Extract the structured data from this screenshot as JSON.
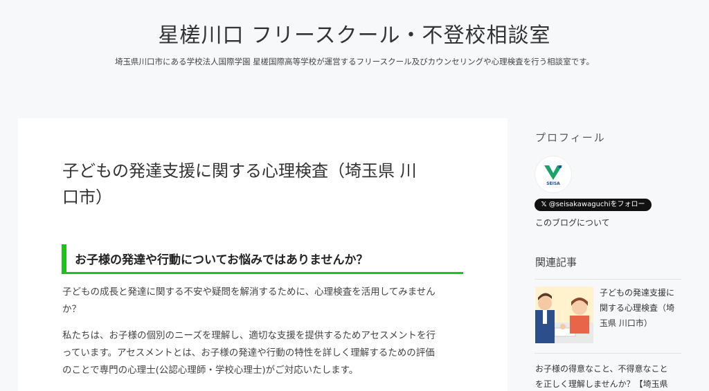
{
  "header": {
    "site_title": "星槎川口 フリースクール・不登校相談室",
    "site_description": "埼玉県川口市にある学校法人国際学園 星槎国際高等学校が運営するフリースクール及びカウンセリングや心理検査を行う相談室です。"
  },
  "article": {
    "title_line1": "子どもの発達支援に関する心理検査（埼玉県 川",
    "title_line2": "口市）",
    "heading": "お子様の発達や行動についてお悩みではありませんか？",
    "p1_line1": "子どもの成長と発達に関する不安や疑問を解消するために、心理検査を活用してみません",
    "p1_line2": "か？",
    "p2_line1": "私たちは、お子様の個別のニーズを理解し、適切な支援を提供するためアセスメントを行",
    "p2_line2": "っています。アセスメントとは、お子様の発達や行動の特性を詳しく理解するための評価",
    "p2_line3": "のことで専門の心理士(公認心理師・学校心理士)がご対応いたします。"
  },
  "sidebar": {
    "profile_title": "プロフィール",
    "avatar_logo_text": "SEISA",
    "follow_button": "@seisakawaguchiをフォロー",
    "follow_icon": "x-logo-icon",
    "about_link": "このブログについて",
    "related_title": "関連記事",
    "related": [
      {
        "line1": "子どもの発達支援に",
        "line2": "関する心理検査（埼",
        "line3": "玉県 川口市）"
      },
      {
        "line1": "お子様の得意なこと、不得意なこと",
        "line2": "を正しく理解しませんか？【埼玉県"
      }
    ]
  },
  "colors": {
    "accent_green": "#1cc31c",
    "background": "#f7f8fa",
    "card": "#ffffff",
    "button_dark": "#111111"
  }
}
